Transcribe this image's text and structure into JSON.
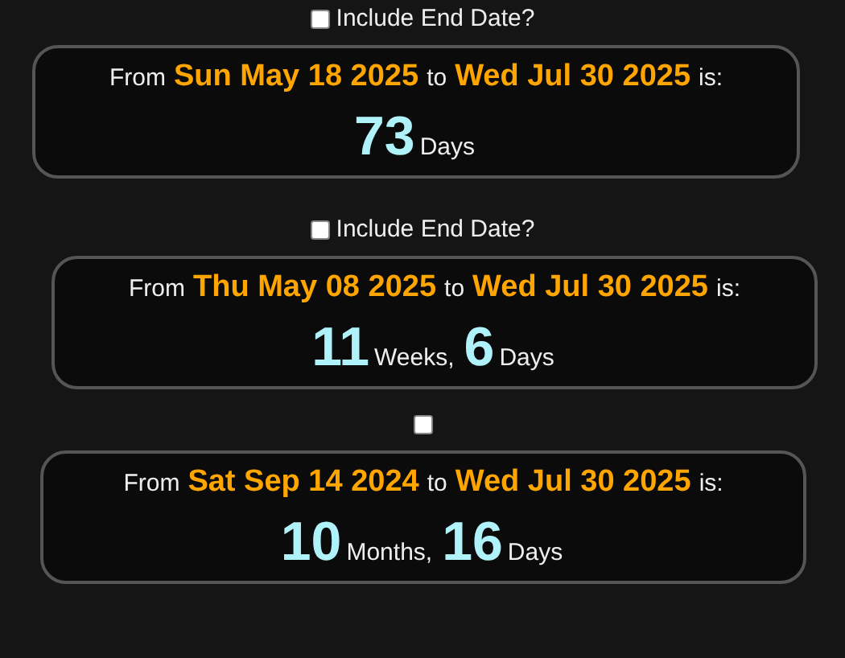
{
  "calculations": [
    {
      "include_end_date": {
        "label": "Include End Date?",
        "checked": false
      },
      "from_label": "From",
      "start": "Sun May 18 2025",
      "to_label": "to",
      "end": "Wed Jul 30 2025",
      "is_label": "is:",
      "result": [
        {
          "number": "73",
          "unit": "Days"
        }
      ]
    },
    {
      "include_end_date": {
        "label": "Include End Date?",
        "checked": false
      },
      "from_label": "From",
      "start": "Thu May 08 2025",
      "to_label": "to",
      "end": "Wed Jul 30 2025",
      "is_label": "is:",
      "result": [
        {
          "number": "11",
          "unit": "Weeks,"
        },
        {
          "number": "6",
          "unit": "Days"
        }
      ]
    },
    {
      "include_end_date": {
        "checked": false
      },
      "from_label": "From",
      "start": "Sat Sep 14 2024",
      "to_label": "to",
      "end": "Wed Jul 30 2025",
      "is_label": "is:",
      "result": [
        {
          "number": "10",
          "unit": "Months,"
        },
        {
          "number": "16",
          "unit": "Days"
        }
      ]
    }
  ]
}
